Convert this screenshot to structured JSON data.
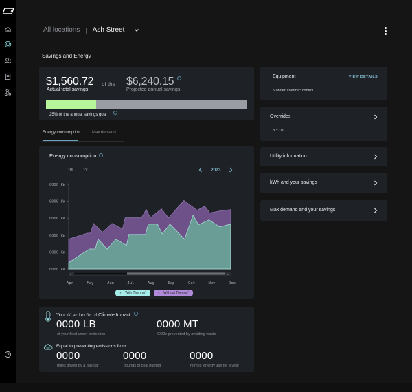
{
  "sidebar": {
    "logo": "glaciergrid-logo",
    "items": [
      {
        "name": "home",
        "icon": "home-icon",
        "active": false
      },
      {
        "name": "savings",
        "icon": "savings-icon",
        "active": true
      },
      {
        "name": "users",
        "icon": "users-icon",
        "active": false
      },
      {
        "name": "reports",
        "icon": "document-icon",
        "active": false
      },
      {
        "name": "network",
        "icon": "network-icon",
        "active": false
      }
    ],
    "help_icon": "help-icon"
  },
  "header": {
    "breadcrumb_root": "All locations",
    "breadcrumb_separator": "|",
    "breadcrumb_current": "Ash Street",
    "menu_icon": "kebab-menu-icon"
  },
  "section_title": "Savings and Energy",
  "savings": {
    "actual_amount": "$1,560.72",
    "actual_label": "Actual total savings",
    "of_the": "of the",
    "projected_amount": "$6,240.15",
    "projected_label": "Projected annual savings",
    "progress_fraction": 0.25,
    "goal_label": "25% of the annual savings goal",
    "progress_color": "#b7f59b"
  },
  "tabs": [
    {
      "label": "Energy consumption",
      "active": true
    },
    {
      "label": "Max demand",
      "active": false
    }
  ],
  "energy_card": {
    "title": "Energy consumption",
    "range_options": [
      "1M",
      "1Y"
    ],
    "year": "2023",
    "legend": [
      {
        "label": "With Therma°",
        "color": "#a6ede9"
      },
      {
        "label": "Without Therma°",
        "color": "#b18bd9"
      }
    ]
  },
  "chart_data": {
    "type": "area",
    "title": "Energy consumption",
    "xlabel": "",
    "ylabel": "kW",
    "y_tick_labels": [
      "0000 kW",
      "0000 kW",
      "0000 kW",
      "0000 kW",
      "0000 kW",
      "0000 kW"
    ],
    "x_tick_labels": [
      "Apr",
      "May",
      "Jun",
      "Jul",
      "Aug",
      "Sep",
      "Oct",
      "Nov",
      "Dec"
    ],
    "x_range": [
      0,
      8
    ],
    "ylim": [
      0,
      5
    ],
    "grid": false,
    "legend_position": "bottom-center",
    "series": [
      {
        "name": "Without Therma°",
        "color": "#6e5189",
        "x": [
          0,
          0.93,
          1.07,
          1.24,
          1.66,
          2.14,
          2.66,
          2.79,
          3.59,
          3.83,
          4.03,
          4.58,
          4.93,
          5.69,
          6.34,
          6.72,
          6.97,
          7.48,
          8.0
        ],
        "y": [
          1.76,
          2.12,
          2.12,
          2.69,
          2.16,
          2.69,
          2.37,
          3.02,
          3.02,
          3.51,
          3.02,
          3.55,
          3.02,
          4.05,
          3.47,
          3.71,
          3.31,
          3.43,
          3.51
        ]
      },
      {
        "name": "With Therma°",
        "color": "#6b9d97",
        "x": [
          0,
          1.03,
          1.31,
          1.45,
          1.9,
          2.34,
          2.86,
          2.97,
          3.79,
          3.93,
          4.38,
          4.62,
          5.0,
          5.72,
          6.14,
          6.41,
          6.93,
          7.45,
          8.0
        ],
        "y": [
          0.37,
          1.18,
          1.18,
          1.76,
          1.18,
          1.76,
          1.39,
          2.04,
          2.04,
          2.65,
          2.65,
          2.08,
          2.65,
          1.76,
          3.18,
          2.61,
          2.9,
          2.49,
          2.65
        ]
      }
    ]
  },
  "impact": {
    "title_prefix": "Your",
    "brand": "GlacierGrid",
    "title_suffix": "Climate Impact",
    "food_value": "0000 LB",
    "food_label": "of your food under protection",
    "co2_value": "0000 MT",
    "co2_label": "CO2e prevented by avoiding waste",
    "emissions_title": "Equal to preventing emissions from",
    "stats": [
      {
        "value": "0000",
        "label": "miles driven by a gas car"
      },
      {
        "value": "0000",
        "label": "pounds of coal burned"
      },
      {
        "value": "0000",
        "label": "homes' energy use for a year"
      }
    ]
  },
  "right_panel": {
    "equipment": {
      "title": "Equipment",
      "link": "VIEW DETAILS",
      "subtitle": "5 under Therma° control"
    },
    "overrides": {
      "title": "Overrides",
      "subtitle": "8 YTD"
    },
    "items": [
      {
        "title": "Utility information"
      },
      {
        "title": "kWh and your savings"
      },
      {
        "title": "Max demand and your savings"
      }
    ]
  }
}
